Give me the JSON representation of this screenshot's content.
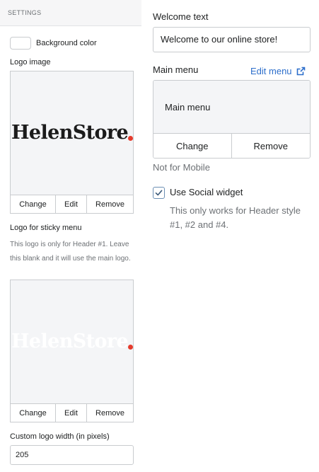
{
  "left_panel": {
    "header": "SETTINGS",
    "background_color_label": "Background color",
    "logo_image_label": "Logo image",
    "logo_text": "HelenStore",
    "logo_buttons": {
      "change": "Change",
      "edit": "Edit",
      "remove": "Remove"
    },
    "sticky_logo_label": "Logo for sticky menu",
    "sticky_help": "This logo is only for Header #1. Leave this blank and it will use the main logo.",
    "sticky_logo_text": "HelenStore",
    "sticky_buttons": {
      "change": "Change",
      "edit": "Edit",
      "remove": "Remove"
    },
    "custom_width_label": "Custom logo width (in pixels)",
    "custom_width_value": "205"
  },
  "right_panel": {
    "welcome_label": "Welcome text",
    "welcome_value": "Welcome to our online store!",
    "main_menu_label": "Main menu",
    "edit_menu_link": "Edit menu",
    "menu_preview_text": "Main menu",
    "menu_buttons": {
      "change": "Change",
      "remove": "Remove"
    },
    "not_for_mobile": "Not for Mobile",
    "social_widget_label": "Use Social widget",
    "social_widget_checked": true,
    "social_widget_help": "This only works for Header style #1, #2 and #4."
  },
  "colors": {
    "accent_link": "#2c6ecb",
    "logo_dot": "#e53b2c",
    "preview_bg": "#f4f5f7"
  },
  "icons": {
    "external_link": "external-link-icon",
    "checkmark": "checkmark-icon"
  }
}
